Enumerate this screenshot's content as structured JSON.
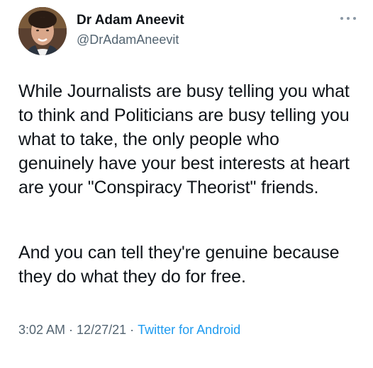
{
  "author": {
    "name": "Dr Adam Aneevit",
    "handle": "@DrAdamAneevit"
  },
  "icons": {
    "avatar": "profile-photo",
    "more": "more-options-icon"
  },
  "tweet": {
    "paragraphs": [
      "While Journalists are busy telling you what to think and Politicians are busy telling you what to take, the only people who genuinely have your best interests at heart are your \"Conspiracy Theorist\" friends.",
      "And you can tell they're genuine because they do what they do for free."
    ],
    "time": "3:02 AM",
    "date": "12/27/21",
    "separator": "·",
    "source": "Twitter for Android"
  },
  "colors": {
    "text": "#0f1419",
    "secondary": "#536471",
    "link": "#1d9bf0"
  }
}
